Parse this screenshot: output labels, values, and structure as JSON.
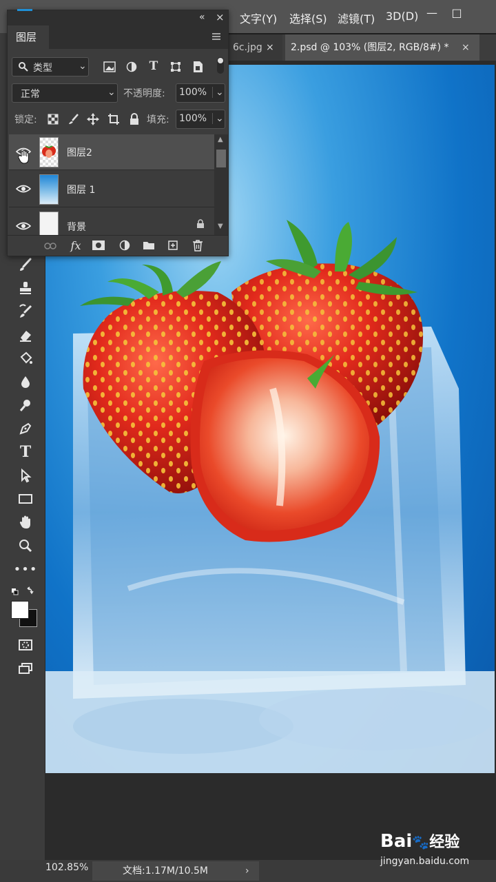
{
  "menubar": {
    "items": [
      "文字(Y)",
      "选择(S)",
      "滤镜(T)",
      "3D(D)"
    ],
    "minimize": "—",
    "maximize": "□"
  },
  "tabs": [
    {
      "label": "6c.jpg",
      "close": "×"
    },
    {
      "label": "2.psd @ 103% (图层2, RGB/8#) *",
      "close": "×"
    }
  ],
  "layers_panel": {
    "title": "图层",
    "collapse": "«",
    "close": "×",
    "filter_kind": "类型",
    "blend_mode": "正常",
    "opacity_label": "不透明度:",
    "opacity_value": "100%",
    "lock_label": "锁定:",
    "fill_label": "填充:",
    "fill_value": "100%",
    "layers": [
      {
        "name": "图层2",
        "visible": true,
        "selected": true
      },
      {
        "name": "图层 1",
        "visible": true,
        "selected": false
      },
      {
        "name": "背景",
        "visible": true,
        "selected": false,
        "locked": true
      }
    ],
    "fx_label": "fx"
  },
  "status": {
    "zoom": "102.85%",
    "doc": "文档:1.17M/10.5M",
    "arrow": "›"
  },
  "watermark": {
    "logo": "Bai",
    "logo_paw": "du",
    "logo_cn": "经验",
    "url": "jingyan.baidu.com"
  },
  "colors": {
    "menubar": "#535353",
    "panel": "#3c3c3c",
    "canvas_sky": "#1073c8",
    "strawberry": "#d8261a"
  }
}
